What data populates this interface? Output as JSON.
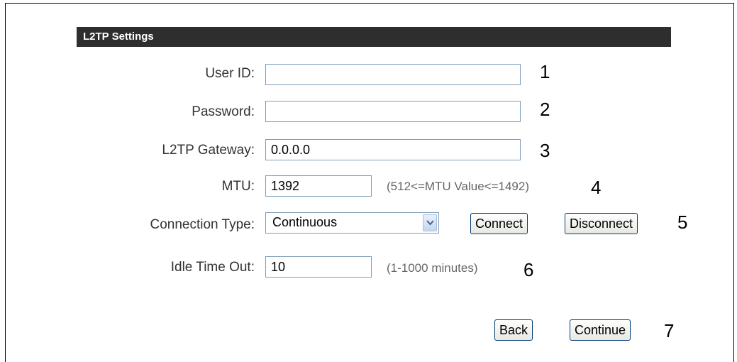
{
  "header": {
    "title": "L2TP Settings"
  },
  "fields": {
    "user_id": {
      "label": "User ID:",
      "value": ""
    },
    "password": {
      "label": "Password:",
      "value": ""
    },
    "gateway": {
      "label": "L2TP Gateway:",
      "value": "0.0.0.0"
    },
    "mtu": {
      "label": "MTU:",
      "value": "1392",
      "hint": "(512<=MTU Value<=1492)"
    },
    "connection_type": {
      "label": "Connection Type:",
      "selected": "Continuous"
    },
    "idle_timeout": {
      "label": "Idle Time Out:",
      "value": "10",
      "hint": "(1-1000 minutes)"
    }
  },
  "buttons": {
    "connect": "Connect",
    "disconnect": "Disconnect",
    "back": "Back",
    "continue": "Continue"
  },
  "callouts": [
    "1",
    "2",
    "3",
    "4",
    "5",
    "6",
    "7"
  ]
}
